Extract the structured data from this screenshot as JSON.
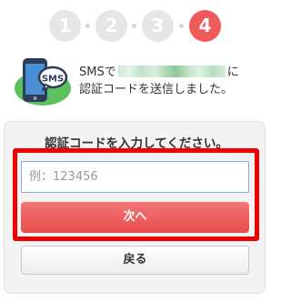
{
  "steps": {
    "items": [
      "1",
      "2",
      "3",
      "4"
    ],
    "active_index": 4
  },
  "notice": {
    "icon": "phone-sms-icon",
    "sms_label": "SMS",
    "line1_prefix": "SMSで",
    "line1_suffix": "に",
    "line2": "認証コードを送信しました。"
  },
  "form": {
    "title": "認証コードを入力してください。",
    "code_input": {
      "value": "",
      "placeholder": "例：123456"
    },
    "next_label": "次へ",
    "back_label": "戻る"
  },
  "colors": {
    "accent": "#ef5a5a",
    "step_inactive": "#e6e6e6",
    "highlight_border": "#ee0000",
    "icon_green": "#5cc15e"
  }
}
